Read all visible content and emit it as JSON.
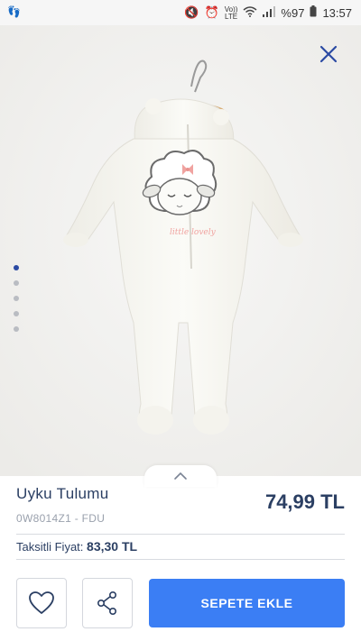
{
  "status_bar": {
    "network": "LTE",
    "voice": "Vo))",
    "battery": "%97",
    "time": "13:57"
  },
  "gallery": {
    "dot_count": 5,
    "active_index": 0
  },
  "product": {
    "title": "Uyku Tulumu",
    "code": "0W8014Z1 - FDU",
    "price": "74,99 TL",
    "installment_label": "Taksitli Fiyat:",
    "installment_price": "83,30 TL",
    "print_text": "little lovely"
  },
  "actions": {
    "add_to_cart": "SEPETE EKLE"
  },
  "colors": {
    "primary": "#3b7ef4",
    "navy": "#2b3f63",
    "muted": "#9aa1ad",
    "accent_pink": "#f0a3a0"
  }
}
